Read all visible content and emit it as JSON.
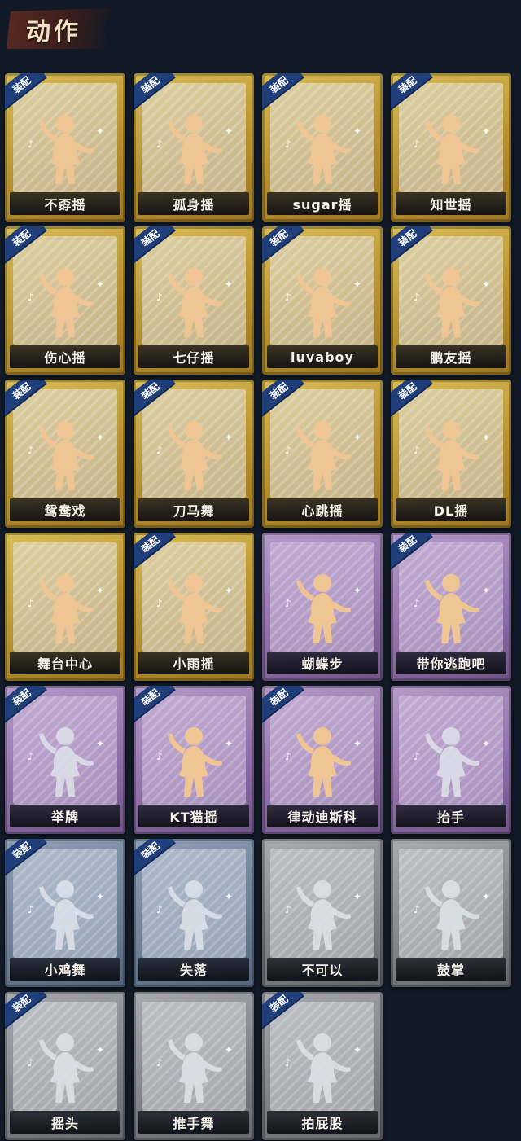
{
  "header": {
    "title": "动作"
  },
  "badge_label": "装配",
  "cards": [
    {
      "label": "不孬摇",
      "tier": "gold",
      "equipped": true,
      "icon": "dance-figure-icon"
    },
    {
      "label": "孤身摇",
      "tier": "gold",
      "equipped": true,
      "icon": "dance-figure-icon"
    },
    {
      "label": "sugar摇",
      "tier": "gold",
      "equipped": true,
      "icon": "dance-figure-icon"
    },
    {
      "label": "知世摇",
      "tier": "gold",
      "equipped": true,
      "icon": "dance-figure-icon"
    },
    {
      "label": "伤心摇",
      "tier": "gold",
      "equipped": true,
      "icon": "heart-hands-figure-icon"
    },
    {
      "label": "七仔摇",
      "tier": "gold",
      "equipped": true,
      "icon": "dance-figure-icon"
    },
    {
      "label": "luvaboy",
      "tier": "gold",
      "equipped": true,
      "icon": "dance-figure-icon"
    },
    {
      "label": "鹏友摇",
      "tier": "gold",
      "equipped": true,
      "icon": "dance-figure-icon"
    },
    {
      "label": "鸳鸯戏",
      "tier": "gold",
      "equipped": true,
      "icon": "dance-figure-icon"
    },
    {
      "label": "刀马舞",
      "tier": "gold",
      "equipped": true,
      "icon": "dance-figure-icon"
    },
    {
      "label": "心跳摇",
      "tier": "gold",
      "equipped": true,
      "icon": "dance-figure-icon"
    },
    {
      "label": "DL摇",
      "tier": "gold",
      "equipped": true,
      "icon": "dance-figure-icon"
    },
    {
      "label": "舞台中心",
      "tier": "gold",
      "equipped": false,
      "icon": "dance-figure-icon"
    },
    {
      "label": "小雨摇",
      "tier": "gold",
      "equipped": true,
      "icon": "dance-figure-icon"
    },
    {
      "label": "蝴蝶步",
      "tier": "purple",
      "equipped": false,
      "icon": "dance-figure-icon"
    },
    {
      "label": "带你逃跑吧",
      "tier": "purple",
      "equipped": true,
      "icon": "dance-figure-icon"
    },
    {
      "label": "举牌",
      "tier": "purple",
      "equipped": true,
      "icon": "hold-sign-figure-icon"
    },
    {
      "label": "KT猫摇",
      "tier": "purple",
      "equipped": true,
      "icon": "dance-figure-icon"
    },
    {
      "label": "律动迪斯科",
      "tier": "purple",
      "equipped": true,
      "icon": "dance-figure-icon"
    },
    {
      "label": "抬手",
      "tier": "purple",
      "equipped": false,
      "icon": "raise-hand-figure-icon"
    },
    {
      "label": "小鸡舞",
      "tier": "blue",
      "equipped": true,
      "icon": "chicken-dance-figure-icon"
    },
    {
      "label": "失落",
      "tier": "blue",
      "equipped": true,
      "icon": "crawl-figure-icon"
    },
    {
      "label": "不可以",
      "tier": "grey",
      "equipped": false,
      "icon": "finger-wag-icon"
    },
    {
      "label": "鼓掌",
      "tier": "grey",
      "equipped": false,
      "icon": "clap-hands-icon"
    },
    {
      "label": "摇头",
      "tier": "grey",
      "equipped": true,
      "icon": "shake-head-figure-icon"
    },
    {
      "label": "推手舞",
      "tier": "grey",
      "equipped": false,
      "icon": "push-hands-figure-icon"
    },
    {
      "label": "拍屁股",
      "tier": "grey",
      "equipped": true,
      "icon": "slap-figure-icon"
    }
  ]
}
